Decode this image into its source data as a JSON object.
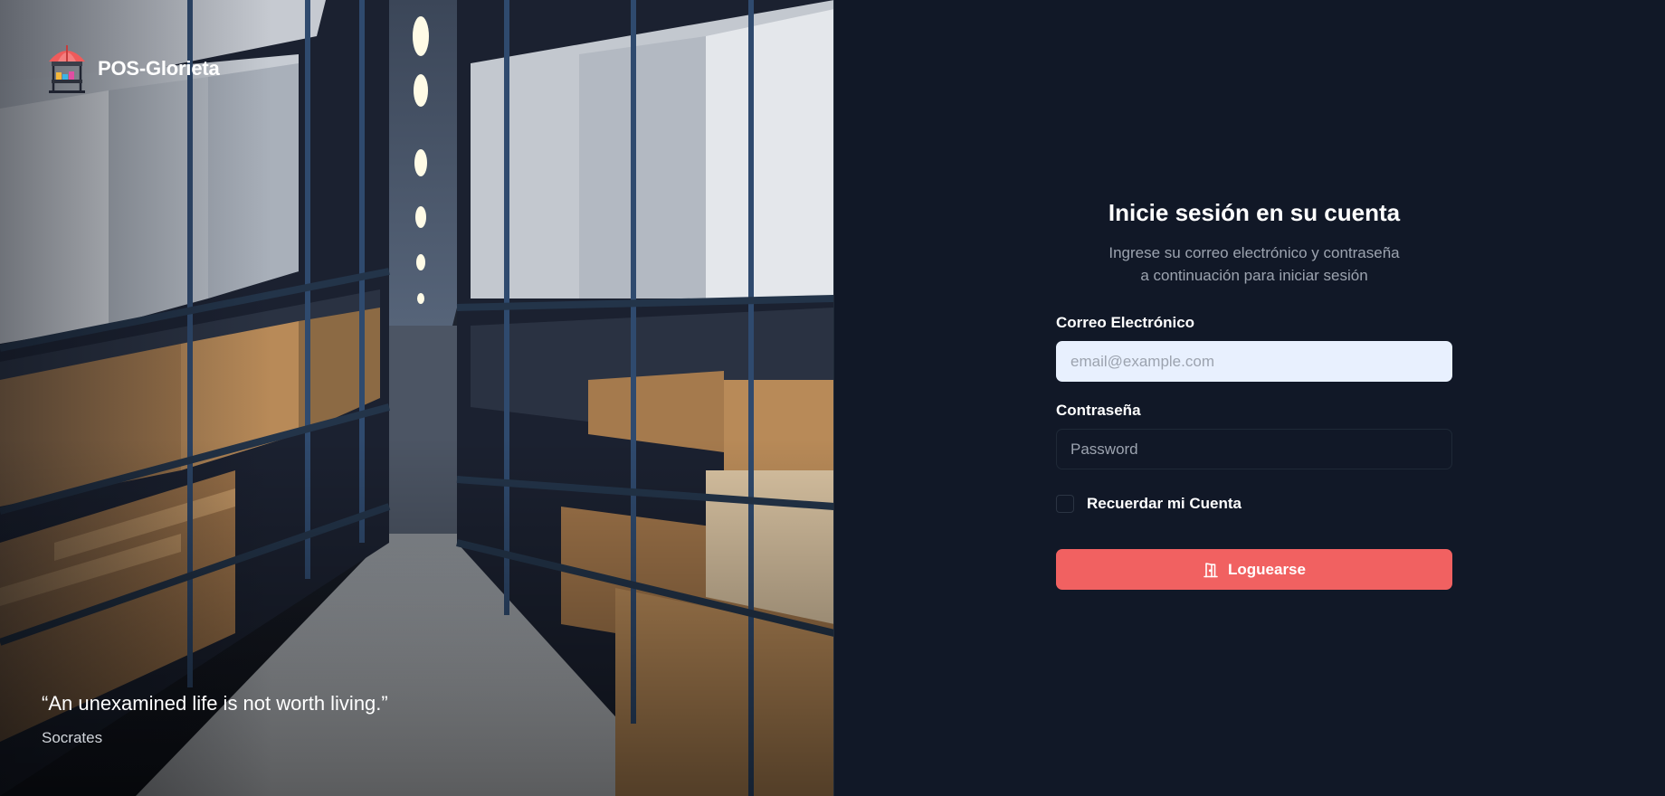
{
  "brand": {
    "name": "POS-Glorieta",
    "logo_icon": "kiosk-umbrella-icon"
  },
  "hero": {
    "image_icon": "warehouse-aisle-photo",
    "quote": "“An unexamined life is not worth living.”",
    "author": "Socrates"
  },
  "login": {
    "title": "Inicie sesión en su cuenta",
    "subtitle_line1": "Ingrese su correo electrónico y contraseña",
    "subtitle_line2": "a continuación para iniciar sesión",
    "email_label": "Correo Electrónico",
    "email_placeholder": "email@example.com",
    "email_value": "",
    "password_label": "Contraseña",
    "password_placeholder": "Password",
    "password_value": "",
    "remember_label": "Recuerdar mi Cuenta",
    "remember_checked": false,
    "submit_label": "Loguearse",
    "submit_icon": "door-enter-icon"
  },
  "colors": {
    "background": "#111827",
    "accent": "#f16161",
    "email_field_bg": "#e8f0fe",
    "muted_text": "#9ca3af"
  }
}
